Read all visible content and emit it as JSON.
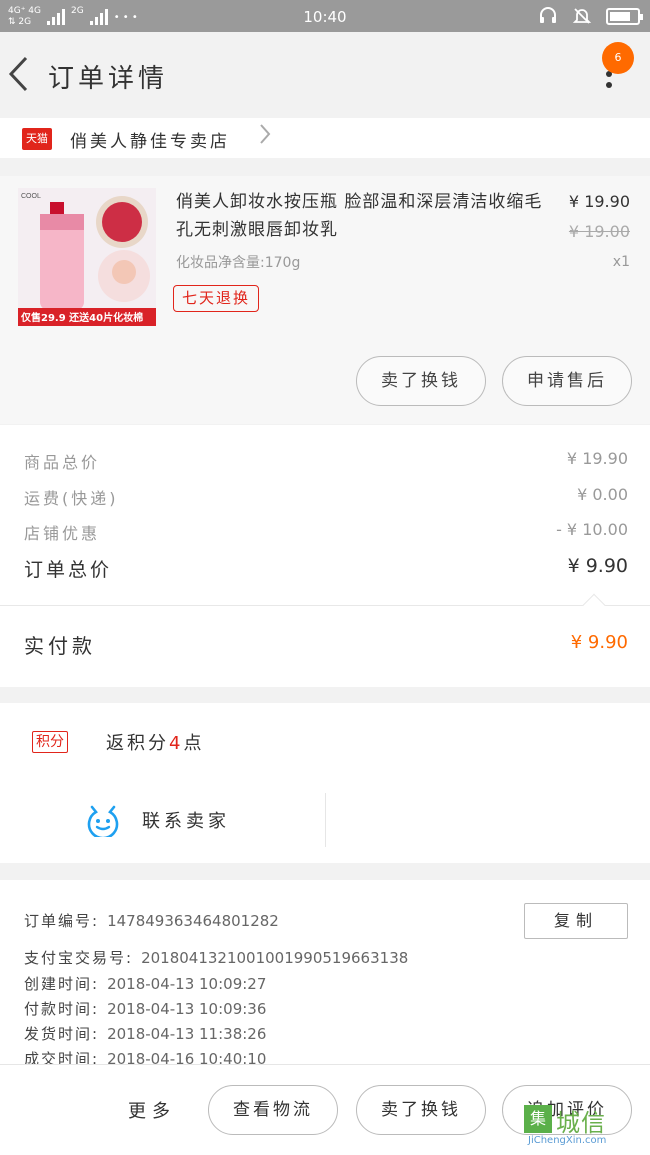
{
  "status_bar": {
    "network_top": "4G⁺ 4G",
    "network_bottom": "⇅ 2G",
    "network2": "2G",
    "dots": "• • •",
    "time": "10:40"
  },
  "header": {
    "title": "订单详情",
    "badge_count": "6"
  },
  "shop": {
    "platform_logo": "天猫",
    "name": "俏美人静佳专卖店"
  },
  "product": {
    "title": "俏美人卸妆水按压瓶 脸部温和深层清洁收缩毛孔无刺激眼唇卸妆乳",
    "spec": "化妆品净含量:170g",
    "price": "¥ 19.90",
    "original_price": "¥ 19.00",
    "quantity": "x1",
    "return_tag": "七天退换",
    "image_promo": "仅售29.9 还送40片化妆棉",
    "image_brand": "COOL",
    "actions": [
      "卖了换钱",
      "申请售后"
    ]
  },
  "totals": {
    "rows": [
      {
        "label": "商品总价",
        "value": "¥ 19.90"
      },
      {
        "label": "运费(快递)",
        "value": "¥ 0.00"
      },
      {
        "label": "店铺优惠",
        "value": "- ¥ 10.00"
      },
      {
        "label": "订单总价",
        "value": "¥ 9.90"
      }
    ],
    "paid_label": "实付款",
    "paid_value": "¥ 9.90"
  },
  "points": {
    "badge": "积分",
    "text_before": "返积分",
    "number": "4",
    "text_after": "点"
  },
  "contact": {
    "label": "联系卖家"
  },
  "order_info": {
    "rows": [
      {
        "label": "订单编号:",
        "value": "147849363464801282"
      },
      {
        "label": "支付宝交易号:",
        "value": "2018041321001001990519663138"
      },
      {
        "label": "创建时间:",
        "value": "2018-04-13 10:09:27"
      },
      {
        "label": "付款时间:",
        "value": "2018-04-13 10:09:36"
      },
      {
        "label": "发货时间:",
        "value": "2018-04-13 11:38:26"
      },
      {
        "label": "成交时间:",
        "value": "2018-04-16 10:40:10"
      }
    ],
    "copy_label": "复制"
  },
  "bottom_bar": {
    "more": "更多",
    "buttons": [
      "查看物流",
      "卖了换钱",
      "追加评价"
    ]
  },
  "watermark": {
    "cn": "城信",
    "box": "集",
    "en": "JiChengXin.com"
  },
  "colors": {
    "accent_orange": "#ff6a00",
    "tmall_red": "#e1251b",
    "status_bar": "#9a9a9a"
  }
}
